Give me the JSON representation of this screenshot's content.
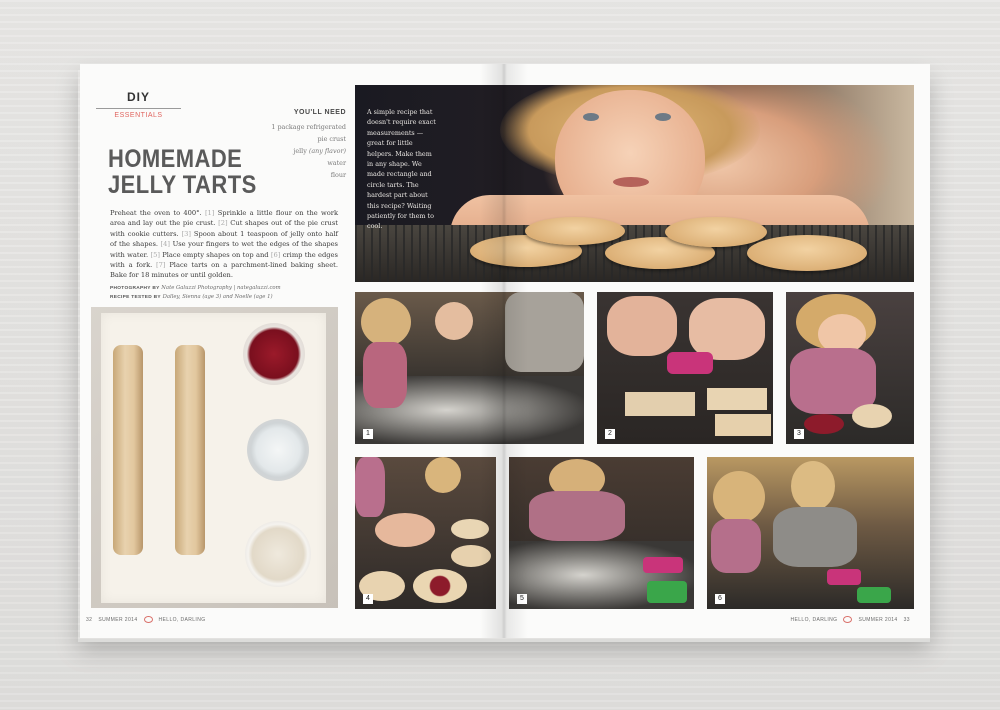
{
  "section": {
    "label": "DIY",
    "sublabel": "ESSENTIALS"
  },
  "title": {
    "line1": "HOMEMADE",
    "line2": "JELLY TARTS"
  },
  "ingredients": {
    "heading": "YOU'LL NEED",
    "item1_a": "1 package refrigerated",
    "item1_b": "pie crust",
    "item2_a": "jelly",
    "item2_b": "(any flavor)",
    "item3": "water",
    "item4": "flour"
  },
  "instructions": {
    "s0": "Preheat the oven to 400°.",
    "n1": "[1]",
    "s1": "Sprinkle a little flour on the work area and lay out the pie crust.",
    "n2": "[2]",
    "s2": "Cut shapes out of the pie crust with cookie cutters.",
    "n3": "[3]",
    "s3": "Spoon about 1 teaspoon of jelly onto half of the shapes.",
    "n4": "[4]",
    "s4": "Use your fingers to wet the edges of the shapes with water.",
    "n5": "[5]",
    "s5": "Place empty shapes on top and",
    "n6": "[6]",
    "s6": "crimp the edges with a fork.",
    "n7": "[7]",
    "s7": "Place tarts on a parchment-lined baking sheet. Bake for 18 minutes or until golden."
  },
  "credits": {
    "photo_label": "PHOTOGRAPHY BY",
    "photo_value": "Nate Galuzzi Photography | nategaluzzi.com",
    "tested_label": "RECIPE TESTED BY",
    "tested_value": "Dalley, Sienna (age 3) and Noelle (age 1)"
  },
  "hero_caption": "A simple recipe that doesn't require exact measurements — great for little helpers. Make them in any shape. We made rectangle and circle tarts. The hardest part about this recipe? Waiting patiently for them to cool.",
  "step_numbers": [
    "1",
    "2",
    "3",
    "4",
    "5",
    "6"
  ],
  "footer_left": {
    "page": "32",
    "issue": "SUMMER 2014",
    "brand": "HELLO, DARLING"
  },
  "footer_right": {
    "brand": "HELLO, DARLING",
    "issue": "SUMMER 2014",
    "page": "33"
  },
  "colors": {
    "accent": "#e0655f",
    "background": "#e4e3e1",
    "paper": "#fbfbfa"
  }
}
